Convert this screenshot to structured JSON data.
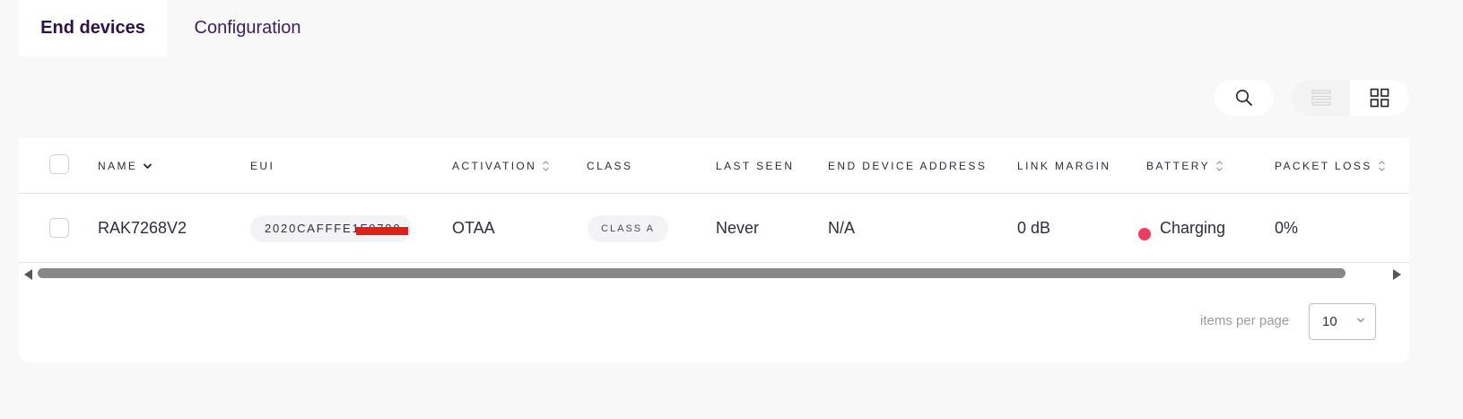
{
  "tabs": [
    {
      "label": "End devices",
      "active": true
    },
    {
      "label": "Configuration",
      "active": false
    }
  ],
  "toolbar": {
    "search_icon": "search-icon",
    "view_modes": [
      "list-view-icon",
      "grid-view-icon"
    ],
    "selected_view": "grid"
  },
  "table": {
    "columns": {
      "name": "NAME",
      "eui": "EUI",
      "activation": "ACTIVATION",
      "class": "CLASS",
      "last_seen": "LAST SEEN",
      "end_device_address": "END DEVICE ADDRESS",
      "link_margin": "LINK MARGIN",
      "battery": "BATTERY",
      "packet_loss": "PACKET LOSS"
    },
    "rows": [
      {
        "name": "RAK7268V2",
        "eui": "2020CAFFFE1F0700",
        "activation": "OTAA",
        "class": "CLASS A",
        "last_seen": "Never",
        "end_device_address": "N/A",
        "link_margin": "0 dB",
        "battery": "Charging",
        "battery_color": "#f03a5f",
        "packet_loss": "0%"
      }
    ]
  },
  "pagination": {
    "items_per_page_label": "items per page",
    "items_per_page_value": "10"
  },
  "colors": {
    "accent": "#2c1347",
    "background": "#f8f8f8",
    "battery_dot": "#f03a5f"
  }
}
